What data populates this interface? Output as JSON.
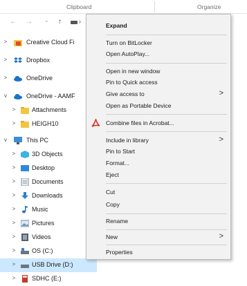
{
  "ribbon": {
    "group1": "Clipboard",
    "group2": "Organize"
  },
  "nav": {
    "back": "←",
    "forward": "→",
    "recent": "⌄",
    "up": "↑",
    "addr_sep": "›"
  },
  "tree": [
    {
      "label": "Creative Cloud Fi",
      "icon": "creative-cloud-files-icon",
      "color": "#e8a33d",
      "chev": ">"
    },
    {
      "label": "Dropbox",
      "icon": "dropbox-icon",
      "color": "#1f6fd1",
      "chev": ">"
    },
    {
      "label": "OneDrive",
      "icon": "onedrive-icon",
      "color": "#1a73c9",
      "chev": ">"
    },
    {
      "label": "OneDrive - AAMF",
      "icon": "onedrive-icon",
      "color": "#1a73c9",
      "chev": "v"
    },
    {
      "label": "Attachments",
      "icon": "folder-icon",
      "color": "#f4c542",
      "chev": ">"
    },
    {
      "label": "HEIGH10",
      "icon": "folder-icon",
      "color": "#f4c542",
      "chev": ">"
    },
    {
      "label": "This PC",
      "icon": "this-pc-icon",
      "color": "#3a8fd6",
      "chev": "v"
    },
    {
      "label": "3D Objects",
      "icon": "3d-objects-icon",
      "color": "#3db3e0",
      "chev": ">"
    },
    {
      "label": "Desktop",
      "icon": "desktop-icon",
      "color": "#2d8ad8",
      "chev": ">"
    },
    {
      "label": "Documents",
      "icon": "documents-icon",
      "color": "#7a8ea3",
      "chev": ">"
    },
    {
      "label": "Downloads",
      "icon": "downloads-icon",
      "color": "#2f7fd1",
      "chev": ">"
    },
    {
      "label": "Music",
      "icon": "music-icon",
      "color": "#2f6fc1",
      "chev": ">"
    },
    {
      "label": "Pictures",
      "icon": "pictures-icon",
      "color": "#6f8fb0",
      "chev": ">"
    },
    {
      "label": "Videos",
      "icon": "videos-icon",
      "color": "#555f6b",
      "chev": ">"
    },
    {
      "label": "OS (C:)",
      "icon": "drive-icon",
      "color": "#6a7680",
      "chev": ">"
    },
    {
      "label": "USB Drive (D:)",
      "icon": "usb-drive-icon",
      "color": "#6a7680",
      "chev": ">",
      "selected": true
    },
    {
      "label": "SDHC (E:)",
      "icon": "sdhc-icon",
      "color": "#c0392b",
      "chev": ">"
    }
  ],
  "menu": {
    "expand": "Expand",
    "bitlocker": "Turn on BitLocker",
    "autoplay": "Open AutoPlay...",
    "new_window": "Open in new window",
    "pin_quick": "Pin to Quick access",
    "give_access": "Give access to",
    "portable": "Open as Portable Device",
    "combine": "Combine files in Acrobat...",
    "include_library": "Include in library",
    "pin_start": "Pin to Start",
    "format": "Format...",
    "eject": "Eject",
    "cut": "Cut",
    "copy": "Copy",
    "rename": "Rename",
    "new": "New",
    "properties": "Properties",
    "submenu_arrow": ">"
  },
  "colors": {
    "selection": "#cce8ff",
    "menu_bg": "#f2f2f2",
    "acrobat_red": "#d93025"
  }
}
